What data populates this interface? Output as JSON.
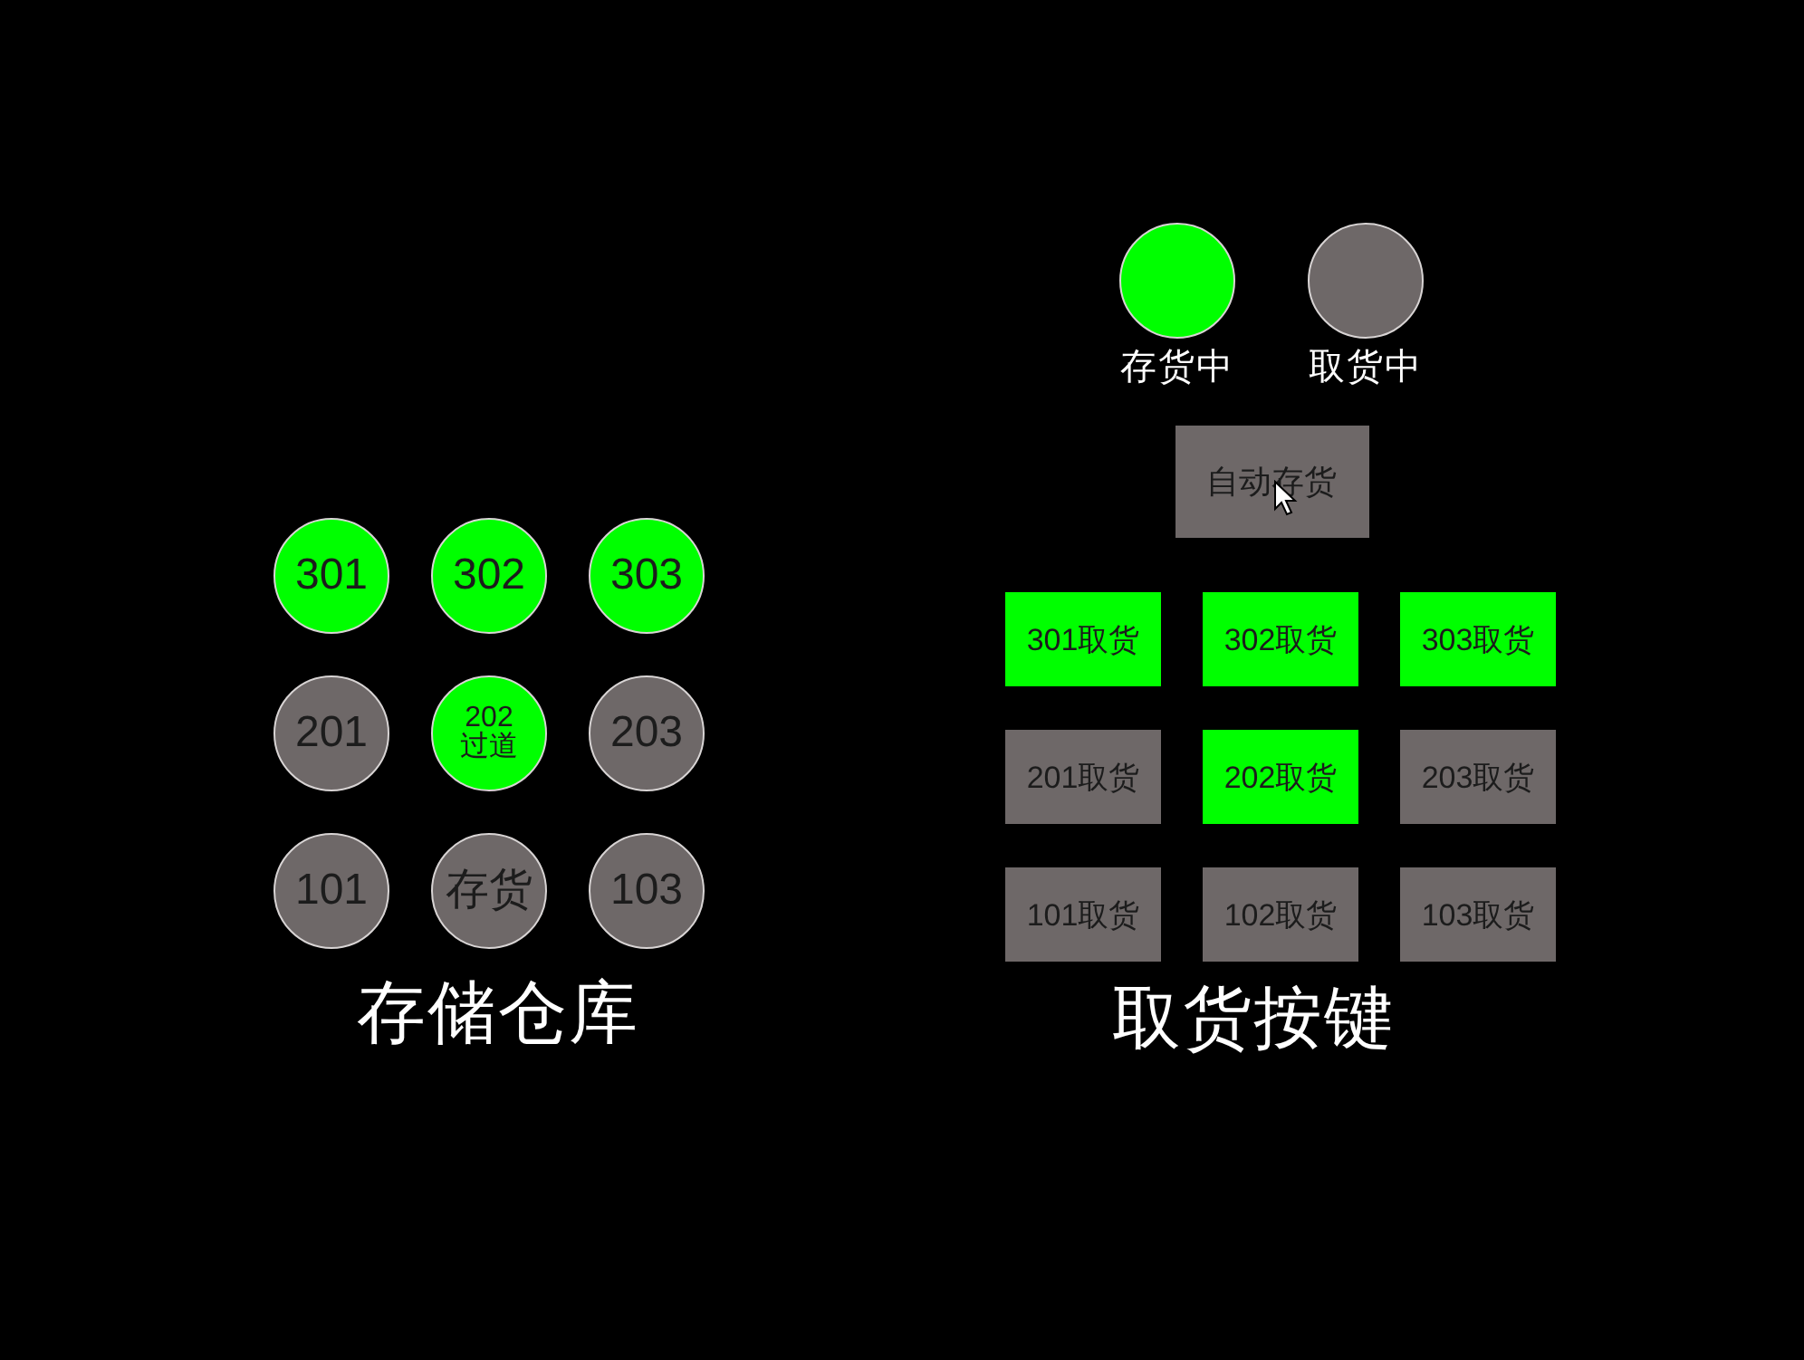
{
  "storage": {
    "slots": [
      {
        "label": "301",
        "on": true
      },
      {
        "label": "302",
        "on": true
      },
      {
        "label": "303",
        "on": true
      },
      {
        "label": "201",
        "on": false
      },
      {
        "label": "202",
        "sublabel": "过道",
        "on": true
      },
      {
        "label": "203",
        "on": false
      },
      {
        "label": "101",
        "on": false
      },
      {
        "label": "存货",
        "on": false
      },
      {
        "label": "103",
        "on": false
      }
    ],
    "title": "存储仓库"
  },
  "pickup": {
    "lamps": [
      {
        "label": "存货中",
        "on": true
      },
      {
        "label": "取货中",
        "on": false
      }
    ],
    "auto_button": {
      "label": "自动存货"
    },
    "buttons": [
      {
        "label": "301取货",
        "on": true
      },
      {
        "label": "302取货",
        "on": true
      },
      {
        "label": "303取货",
        "on": true
      },
      {
        "label": "201取货",
        "on": false
      },
      {
        "label": "202取货",
        "on": true
      },
      {
        "label": "203取货",
        "on": false
      },
      {
        "label": "101取货",
        "on": false
      },
      {
        "label": "102取货",
        "on": false
      },
      {
        "label": "103取货",
        "on": false
      }
    ],
    "title": "取货按键"
  }
}
